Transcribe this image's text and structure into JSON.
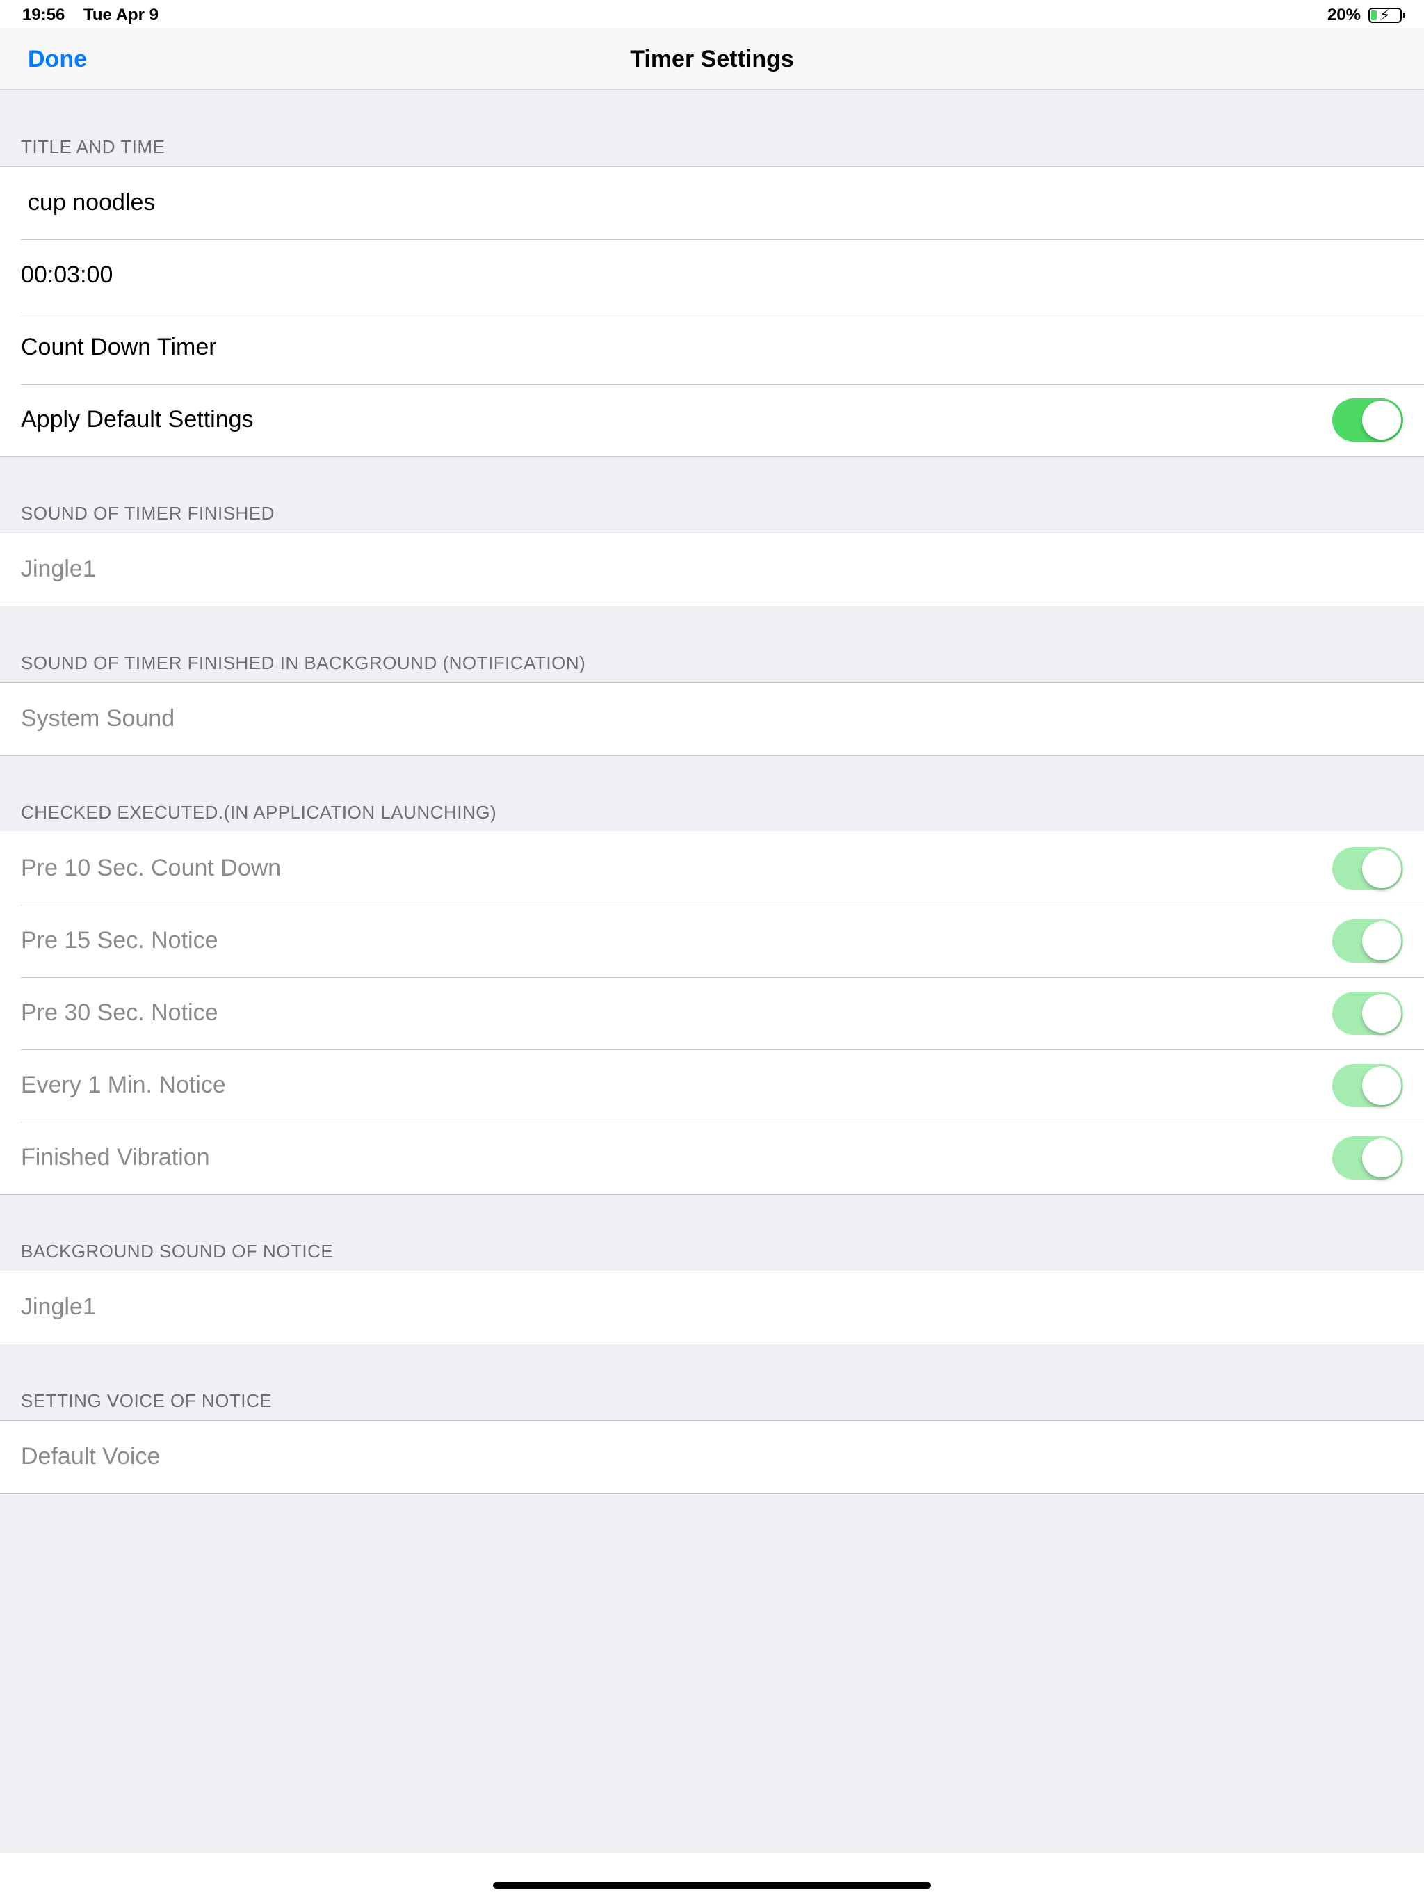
{
  "status": {
    "time": "19:56",
    "date": "Tue Apr 9",
    "battery": "20%",
    "battery_icon": "battery-charging-icon"
  },
  "nav": {
    "done": "Done",
    "title": "Timer Settings"
  },
  "sections": {
    "title_time": {
      "header": "TITLE AND TIME",
      "title_value": "cup noodles",
      "time_value": "00:03:00",
      "timer_type": "Count Down Timer",
      "apply_default": "Apply Default Settings",
      "apply_default_on": true
    },
    "sound_finished": {
      "header": "SOUND OF TIMER FINISHED",
      "value": "Jingle1"
    },
    "sound_background": {
      "header": "SOUND OF TIMER FINISHED IN BACKGROUND (NOTIFICATION)",
      "value": "System Sound"
    },
    "checked_executed": {
      "header": "CHECKED EXECUTED.(IN APPLICATION LAUNCHING)",
      "items": [
        {
          "label": "Pre 10 Sec. Count Down",
          "on": true
        },
        {
          "label": "Pre 15 Sec. Notice",
          "on": true
        },
        {
          "label": "Pre 30 Sec. Notice",
          "on": true
        },
        {
          "label": "Every 1 Min. Notice",
          "on": true
        },
        {
          "label": "Finished Vibration",
          "on": true
        }
      ]
    },
    "background_notice": {
      "header": "BACKGROUND SOUND OF NOTICE",
      "value": "Jingle1"
    },
    "voice_notice": {
      "header": "SETTING VOICE OF NOTICE",
      "value": "Default Voice"
    }
  },
  "colors": {
    "accent": "#007aff",
    "toggle_on": "#4cd964",
    "toggle_disabled": "#a5ecb1",
    "background": "#efeff4"
  }
}
